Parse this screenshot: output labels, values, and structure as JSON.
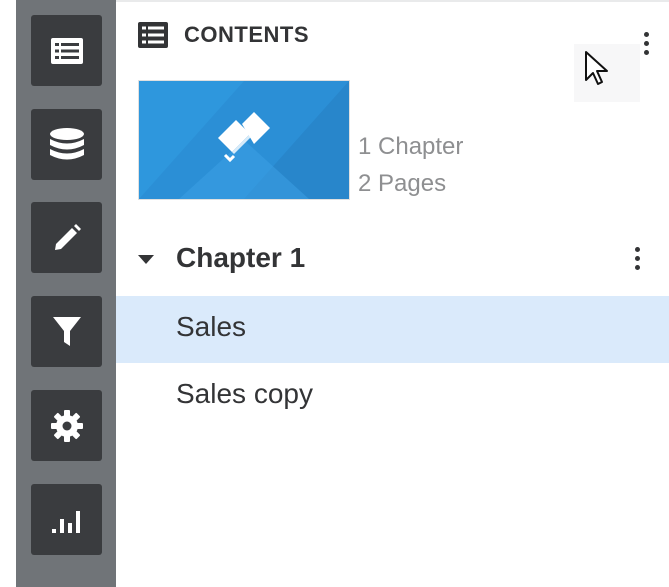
{
  "sidebar": {
    "buttons": [
      {
        "name": "contents-list-icon"
      },
      {
        "name": "database-icon"
      },
      {
        "name": "pencil-icon"
      },
      {
        "name": "filter-icon"
      },
      {
        "name": "gear-icon"
      },
      {
        "name": "bar-chart-icon"
      }
    ]
  },
  "panel": {
    "title": "CONTENTS",
    "menu_icon": "more-vertical-icon",
    "book": {
      "chapters_label": "1 Chapter",
      "pages_label": "2 Pages",
      "thumbnail_icon": "book-icon",
      "thumbnail_color": "#2b8fd6"
    },
    "chapters": [
      {
        "title": "Chapter 1",
        "expanded": true,
        "pages": [
          {
            "label": "Sales",
            "selected": true
          },
          {
            "label": "Sales copy",
            "selected": false
          }
        ]
      }
    ]
  },
  "colors": {
    "rail": "#707478",
    "rail_button": "#3a3c3f",
    "selected_row": "#daeafb",
    "text": "#333436",
    "muted_text": "#8e8f91"
  }
}
